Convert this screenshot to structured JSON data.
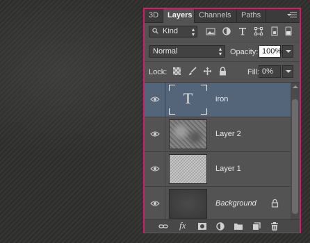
{
  "tabs": [
    {
      "label": "3D",
      "active": false
    },
    {
      "label": "Layers",
      "active": true
    },
    {
      "label": "Channels",
      "active": false
    },
    {
      "label": "Paths",
      "active": false
    }
  ],
  "filter": {
    "kind_label": "Kind",
    "icons": [
      "image-filter-icon",
      "adjustment-filter-icon",
      "type-filter-icon",
      "shape-filter-icon",
      "smart-object-filter-icon",
      "filter-toggle-icon"
    ]
  },
  "blend": {
    "mode": "Normal",
    "opacity_label": "Opacity:",
    "opacity_value": "100%"
  },
  "lock": {
    "label": "Lock:",
    "icons": [
      "lock-transparency-icon",
      "lock-image-icon",
      "lock-position-icon",
      "lock-all-icon"
    ],
    "fill_label": "Fill:",
    "fill_value": "0%"
  },
  "layers": [
    {
      "name": "iron",
      "kind": "type",
      "thumb_text": "T",
      "selected": true
    },
    {
      "name": "Layer 2",
      "kind": "stone",
      "selected": false
    },
    {
      "name": "Layer 1",
      "kind": "metal",
      "selected": false
    },
    {
      "name": "Background",
      "kind": "background",
      "selected": false,
      "locked": true
    }
  ],
  "bottom_bar": {
    "fx_label": "fx",
    "icons": [
      "link-layers-icon",
      "layer-style-icon",
      "add-mask-icon",
      "adjustment-layer-icon",
      "new-group-icon",
      "new-layer-icon",
      "delete-layer-icon"
    ]
  },
  "colors": {
    "panel_border": "#d61b6b",
    "selected_row": "#556579",
    "panel_bg": "#535353"
  }
}
